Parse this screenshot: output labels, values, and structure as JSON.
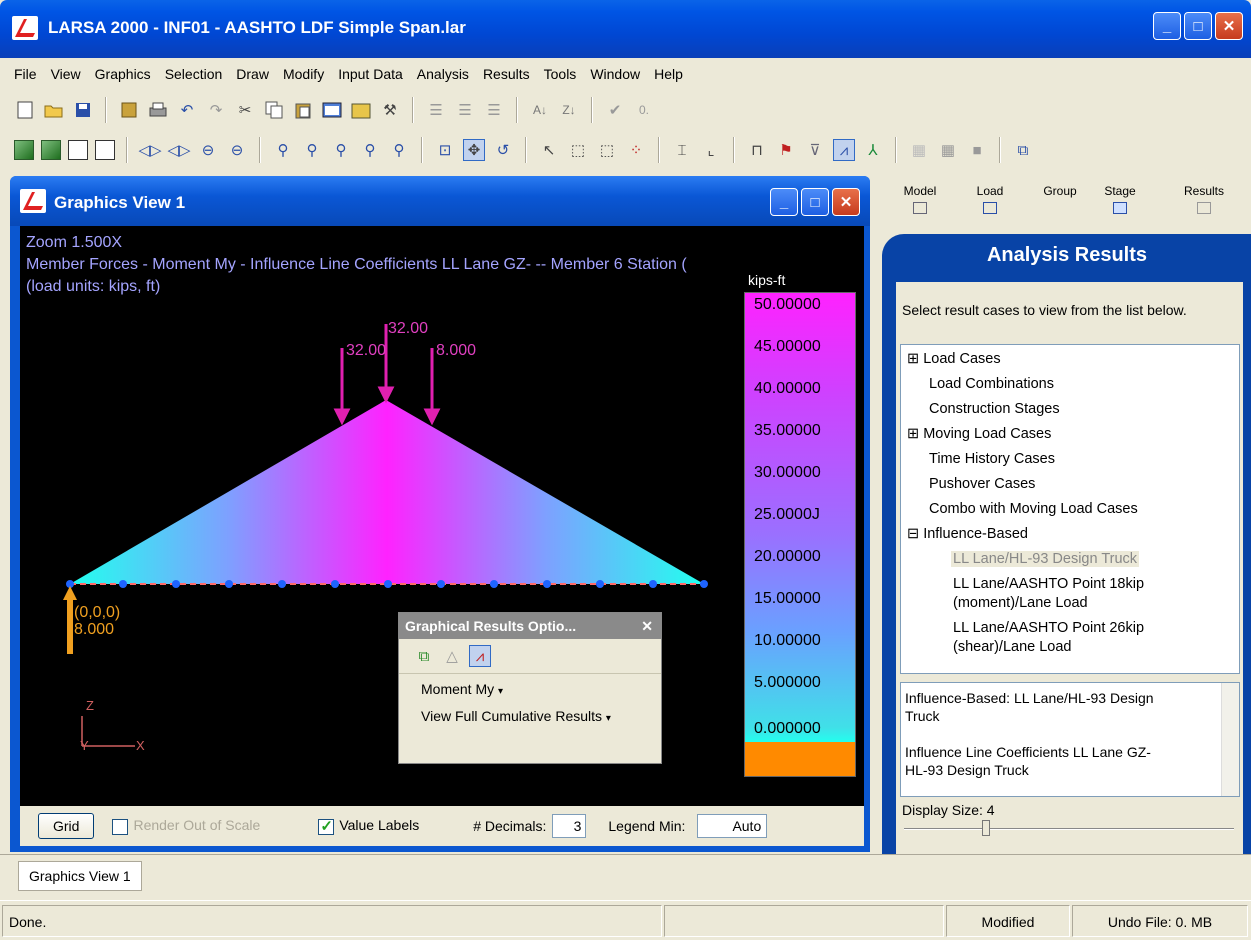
{
  "app": {
    "title": "LARSA 2000 - INF01 - AASHTO LDF Simple Span.lar",
    "controls": {
      "minimize": "_",
      "maximize": "□",
      "close": "✕"
    }
  },
  "menu": [
    "File",
    "View",
    "Graphics",
    "Selection",
    "Draw",
    "Modify",
    "Input Data",
    "Analysis",
    "Results",
    "Tools",
    "Window",
    "Help"
  ],
  "toolbar": {
    "zero_label": "0."
  },
  "graphics_view": {
    "title": "Graphics View 1",
    "zoom": "Zoom  1.500X",
    "caption": "Member Forces - Moment My - Influence Line Coefficients LL Lane GZ- -- Member 6 Station (",
    "units": "(load units: kips, ft)",
    "loads": {
      "center": "32.00",
      "left": "32.00",
      "right": "8.000"
    },
    "support_label": "(0,0,0)",
    "support_value": "8.000",
    "axes": {
      "z": "Z",
      "y": "Y",
      "x": "X"
    },
    "legend": {
      "unit": "kips-ft",
      "values": [
        "50.00000",
        "45.00000",
        "40.00000",
        "35.00000",
        "30.00000",
        "25.0000J",
        "20.00000",
        "15.00000",
        "10.00000",
        "5.000000",
        "0.000000"
      ]
    },
    "bottom": {
      "grid": "Grid",
      "render_out_of_scale": "Render Out of Scale",
      "value_labels": "Value Labels",
      "decimals_label": "# Decimals:",
      "decimals_value": "3",
      "legend_min_label": "Legend Min:",
      "legend_min_value": "Auto"
    }
  },
  "gro_dialog": {
    "title": "Graphical Results Optio...",
    "close": "✕",
    "moment": "Moment My",
    "cumulative": "View Full Cumulative Results"
  },
  "right_tabs": [
    "Model",
    "Load",
    "Group",
    "Stage",
    "Results"
  ],
  "analysis_results": {
    "title": "Analysis Results",
    "hint": "Select result cases to view from the list below.",
    "tree": [
      {
        "label": "Load Cases",
        "expander": "⊞"
      },
      {
        "label": "Load Combinations"
      },
      {
        "label": "Construction Stages"
      },
      {
        "label": "Moving Load Cases",
        "expander": "⊞"
      },
      {
        "label": "Time History Cases"
      },
      {
        "label": "Pushover Cases"
      },
      {
        "label": "Combo with Moving Load Cases"
      },
      {
        "label": "Influence-Based",
        "expander": "⊟"
      },
      {
        "label": "LL Lane/HL-93 Design Truck"
      },
      {
        "label": "LL Lane/AASHTO Point 18kip"
      },
      {
        "label": "(moment)/Lane Load"
      },
      {
        "label": "LL Lane/AASHTO Point 26kip"
      },
      {
        "label": "(shear)/Lane Load"
      }
    ],
    "description": [
      "Influence-Based: LL Lane/HL-93 Design",
      "Truck",
      "Influence Line Coefficients LL Lane GZ-",
      "HL-93 Design Truck"
    ],
    "display_size": "Display Size: 4"
  },
  "doc_tab": "Graphics View 1",
  "status": {
    "message": "Done.",
    "modified": "Modified",
    "undo": "Undo File: 0. MB"
  }
}
